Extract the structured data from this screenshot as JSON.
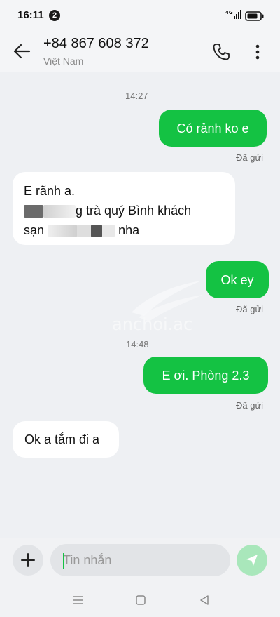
{
  "status_bar": {
    "time": "16:11",
    "notification_count": "2",
    "network": "4G"
  },
  "header": {
    "contact_number": "+84 867 608 372",
    "contact_subtitle": "Việt Nam"
  },
  "chat": {
    "timestamps": [
      "14:27",
      "14:48"
    ],
    "messages": [
      {
        "direction": "outgoing",
        "text": "Có rảnh ko e",
        "status": "Đã gửi"
      },
      {
        "direction": "incoming",
        "line1": "E rãnh a.",
        "line2_visible": "g trà quý Bình khách",
        "line3_prefix": "sạn",
        "line3_suffix": "nha"
      },
      {
        "direction": "outgoing",
        "text": "Ok ey",
        "status": "Đã gửi"
      },
      {
        "direction": "outgoing",
        "text": "E ơi. Phòng 2.3",
        "status": "Đã gửi"
      },
      {
        "direction": "incoming",
        "text": "Ok a tắm đi a"
      }
    ],
    "watermark": "anchoi.ac"
  },
  "composer": {
    "placeholder": "Tin nhắn"
  },
  "colors": {
    "accent": "#14c243",
    "send_disabled": "#a9e7bb",
    "background": "#eef0f3"
  },
  "icons": {
    "back": "arrow-left-icon",
    "call": "phone-icon",
    "more": "more-vertical-icon",
    "add": "plus-icon",
    "send": "send-icon",
    "nav_recents": "menu-lines-icon",
    "nav_home": "square-icon",
    "nav_back": "triangle-back-icon"
  }
}
